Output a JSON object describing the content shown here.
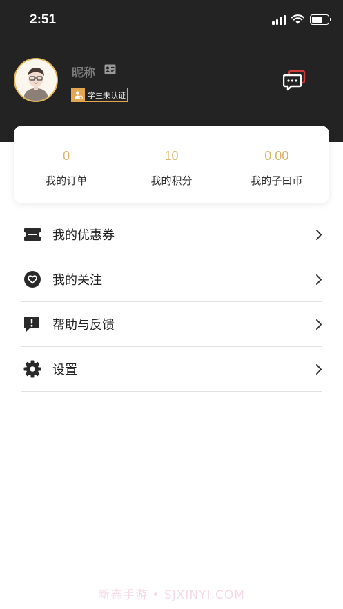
{
  "status_bar": {
    "time": "2:51"
  },
  "profile": {
    "nickname": "昵称",
    "student_badge": "学生未认证"
  },
  "stats": [
    {
      "value": "0",
      "label": "我的订单"
    },
    {
      "value": "10",
      "label": "我的积分"
    },
    {
      "value": "0.00",
      "label": "我的子曰币"
    }
  ],
  "menu": [
    {
      "label": "我的优惠券",
      "icon": "coupon-icon"
    },
    {
      "label": "我的关注",
      "icon": "heart-icon"
    },
    {
      "label": "帮助与反馈",
      "icon": "feedback-icon"
    },
    {
      "label": "设置",
      "icon": "gear-icon"
    }
  ],
  "watermark": "新鑫手游 • SJXINYI.COM",
  "colors": {
    "header_bg": "#232323",
    "accent_gold": "#d9b468",
    "badge_orange": "#e5a651"
  }
}
